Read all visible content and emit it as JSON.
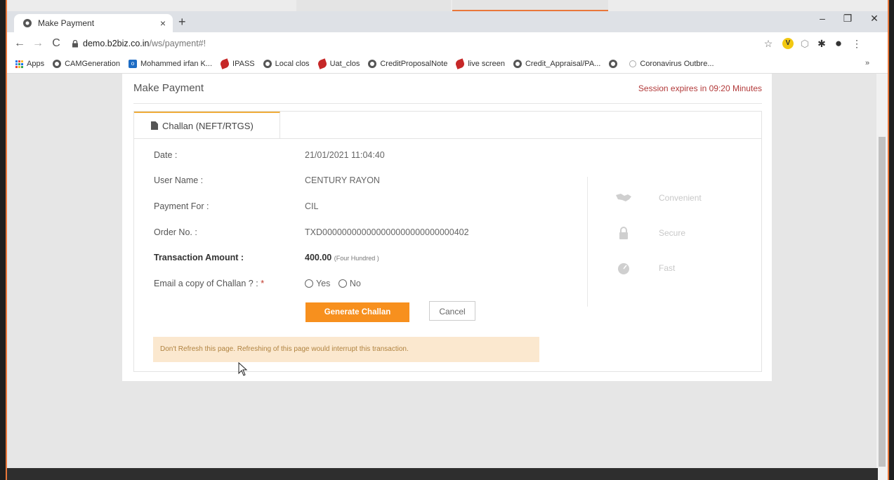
{
  "browser": {
    "tab_title": "Make Payment",
    "tab_close": "×",
    "new_tab": "+",
    "url_host": "demo.b2biz.co.in",
    "url_path": "/ws/payment#!",
    "window_controls": [
      "–",
      "❐",
      "✕"
    ],
    "bookmarks": [
      {
        "label": "Apps",
        "icon": "apps-grid-icon"
      },
      {
        "label": "CAMGeneration",
        "icon": "globe-icon"
      },
      {
        "label": "Mohammed irfan K...",
        "icon": "outlook-icon"
      },
      {
        "label": "IPASS",
        "icon": "leaf-icon"
      },
      {
        "label": "Local clos",
        "icon": "globe-icon"
      },
      {
        "label": "Uat_clos",
        "icon": "leaf-icon"
      },
      {
        "label": "CreditProposalNote",
        "icon": "globe-icon"
      },
      {
        "label": "live screen",
        "icon": "leaf-icon"
      },
      {
        "label": "Credit_Appraisal/PA...",
        "icon": "globe-icon"
      },
      {
        "label": "",
        "icon": "globe-icon"
      },
      {
        "label": "Coronavirus Outbre...",
        "icon": "info-icon"
      }
    ],
    "bookmarks_overflow": "»"
  },
  "page": {
    "title": "Make Payment",
    "session": "Session expires in 09:20 Minutes",
    "tab_label": "Challan (NEFT/RTGS)",
    "fields": {
      "date_label": "Date :",
      "date_value": "21/01/2021 11:04:40",
      "user_label": "User Name :",
      "user_value": "CENTURY RAYON",
      "payment_for_label": "Payment For :",
      "payment_for_value": "CIL",
      "order_label": "Order No. :",
      "order_value": "TXD000000000000000000000000000402",
      "amount_label": "Transaction Amount :",
      "amount_value": "400.00",
      "amount_words": "(Four Hundred )",
      "email_label": "Email a copy of Challan ? :",
      "required_mark": "*",
      "yes_label": "Yes",
      "no_label": "No"
    },
    "generate_button": "Generate Challan",
    "cancel_button": "Cancel",
    "warning": "Don't Refresh this page. Refreshing of this page would interrupt this transaction.",
    "features": [
      {
        "label": "Convenient",
        "icon": "handshake-icon"
      },
      {
        "label": "Secure",
        "icon": "lock-icon"
      },
      {
        "label": "Fast",
        "icon": "speedometer-icon"
      }
    ]
  },
  "colors": {
    "accent": "#f7901e",
    "session_red": "#b23a3a",
    "warning_bg": "#fbe8cf",
    "frame_orange": "#e9773a"
  }
}
